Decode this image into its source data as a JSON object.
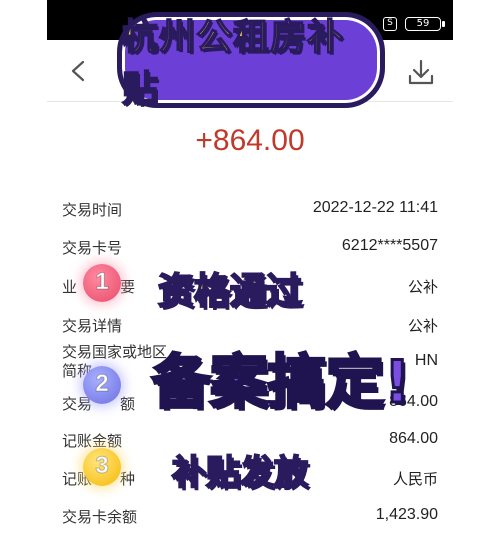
{
  "statusbar": {
    "s_icon": "S",
    "battery": "59"
  },
  "navbar": {
    "back_icon": "chevron-left-icon",
    "download_icon": "download-icon"
  },
  "title_banner": "杭州公租房补贴",
  "amount": "+864.00",
  "rows": {
    "time": {
      "label": "交易时间",
      "value": "2022-12-22 11:41"
    },
    "card": {
      "label": "交易卡号",
      "value": "6212****5507"
    },
    "biz": {
      "label_visible": "业",
      "label_visible_2": "要",
      "value": "公补"
    },
    "detail": {
      "label": "交易详情",
      "value": "公补"
    },
    "country": {
      "label_line1": "交易国家或地区",
      "label_line2": "简称",
      "value": "HN"
    },
    "amount_row": {
      "label": "交易",
      "label_suffix": "额",
      "value": "864.00"
    },
    "booked": {
      "label": "记账金额",
      "value": "864.00"
    },
    "currency": {
      "label": "记账",
      "label_suffix": "种",
      "value": "人民币"
    },
    "balance": {
      "label": "交易卡余额",
      "value": "1,423.90"
    }
  },
  "overlays": {
    "step1": "资格通过",
    "step2": "备案搞定!",
    "step3": "补贴发放"
  },
  "badges": [
    "1",
    "2",
    "3"
  ],
  "colors": {
    "amount": "#c0392b",
    "banner_bg": "#6c3fd6",
    "overlay_yellow": "#ffe14d",
    "overlay_purple": "#7b4de0"
  }
}
